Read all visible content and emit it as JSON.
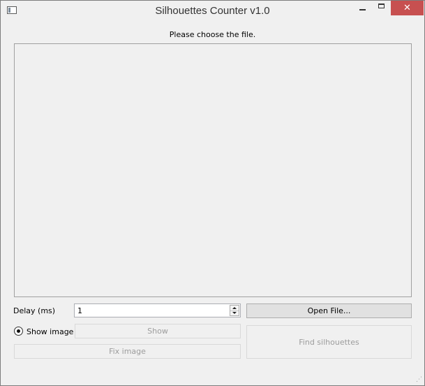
{
  "window": {
    "title": "Silhouettes Counter v1.0",
    "close_glyph": "✕"
  },
  "main": {
    "status_text": "Please choose the file."
  },
  "controls": {
    "delay_label": "Delay (ms)",
    "delay_value": "1",
    "open_file_label": "Open File...",
    "show_image_label": "Show image",
    "show_image_selected": true,
    "show_label": "Show",
    "fix_image_label": "Fix image",
    "find_silhouettes_label": "Find silhouettes"
  },
  "colors": {
    "window_bg": "#f0f0f0",
    "close_button_bg": "#c75050",
    "disabled_text": "#9c9c9c"
  }
}
